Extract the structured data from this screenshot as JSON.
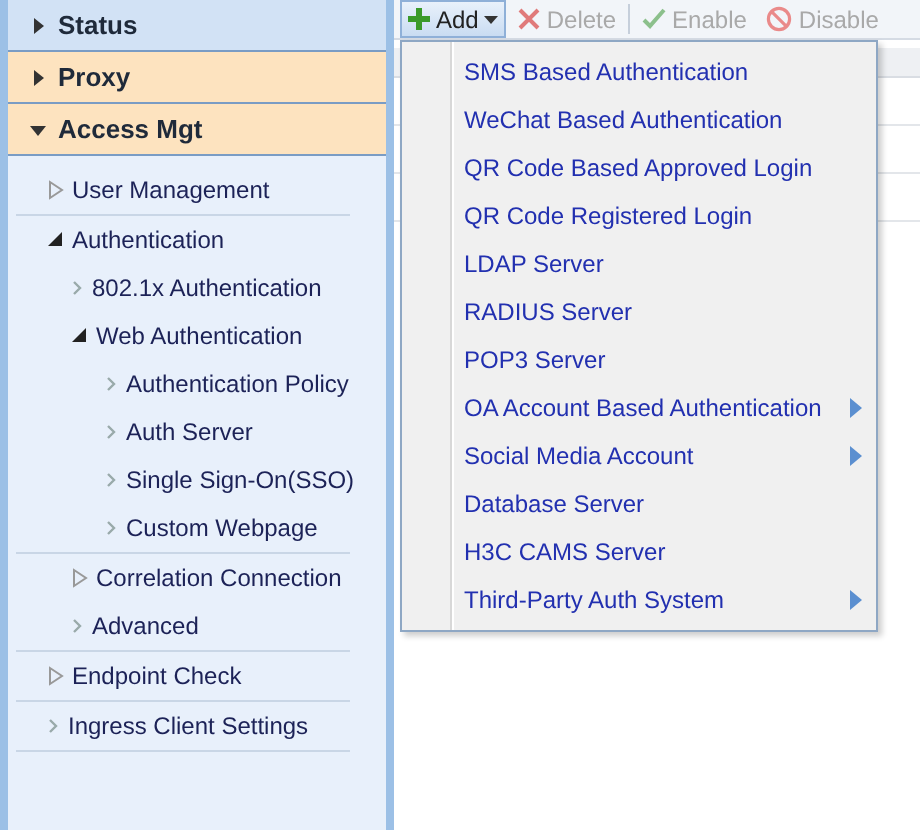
{
  "sidebar": {
    "sections": [
      {
        "label": "Status",
        "expanded": false,
        "color": "#d2e2f5"
      },
      {
        "label": "Proxy",
        "expanded": false,
        "color": "#fde3bf"
      },
      {
        "label": "Access Mgt",
        "expanded": true,
        "color": "#fde3bf",
        "tree": [
          {
            "label": "User Management",
            "kind": "branch",
            "expanded": false
          },
          {
            "label": "Authentication",
            "kind": "branch",
            "expanded": true,
            "children": [
              {
                "label": "802.1x Authentication",
                "kind": "leaf"
              },
              {
                "label": "Web Authentication",
                "kind": "branch",
                "expanded": true,
                "children": [
                  {
                    "label": "Authentication Policy",
                    "kind": "leaf"
                  },
                  {
                    "label": "Auth Server",
                    "kind": "leaf"
                  },
                  {
                    "label": "Single Sign-On(SSO)",
                    "kind": "leaf"
                  },
                  {
                    "label": "Custom Webpage",
                    "kind": "leaf"
                  }
                ]
              },
              {
                "label": "Correlation Connection",
                "kind": "branch",
                "expanded": false
              },
              {
                "label": "Advanced",
                "kind": "leaf"
              }
            ]
          },
          {
            "label": "Endpoint Check",
            "kind": "branch",
            "expanded": false
          },
          {
            "label": "Ingress Client Settings",
            "kind": "leaf"
          }
        ]
      }
    ]
  },
  "toolbar": [
    {
      "label": "Add",
      "kind": "add",
      "disabled": false,
      "open": true
    },
    {
      "label": "Delete",
      "kind": "delete",
      "disabled": true
    },
    {
      "label": "Enable",
      "kind": "enable",
      "disabled": true
    },
    {
      "label": "Disable",
      "kind": "disable",
      "disabled": true
    }
  ],
  "add_menu": [
    {
      "label": "SMS Based Authentication",
      "submenu": false
    },
    {
      "label": "WeChat Based Authentication",
      "submenu": false
    },
    {
      "label": "QR Code Based Approved Login",
      "submenu": false
    },
    {
      "label": "QR Code Registered Login",
      "submenu": false
    },
    {
      "label": "LDAP Server",
      "submenu": false
    },
    {
      "label": "RADIUS Server",
      "submenu": false
    },
    {
      "label": "POP3 Server",
      "submenu": false
    },
    {
      "label": "OA Account Based Authentication",
      "submenu": true
    },
    {
      "label": "Social Media Account",
      "submenu": true
    },
    {
      "label": "Database Server",
      "submenu": false
    },
    {
      "label": "H3C CAMS Server",
      "submenu": false
    },
    {
      "label": "Third-Party Auth System",
      "submenu": true
    }
  ]
}
